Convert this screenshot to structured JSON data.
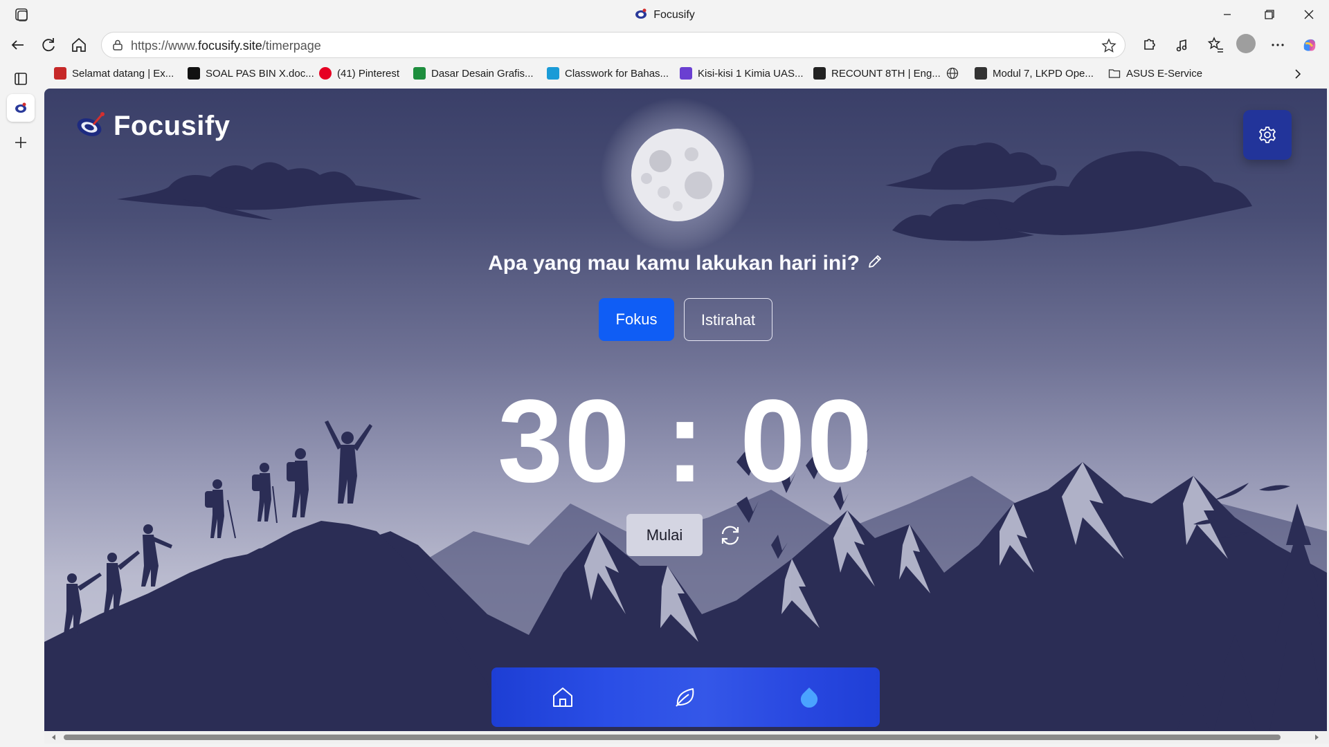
{
  "browser": {
    "window_title": "Focusify",
    "url_prefix": "https://www.",
    "url_domain": "focusify.site",
    "url_path": "/timerpage",
    "bookmarks": [
      {
        "label": "Selamat datang | Ex...",
        "icon": "mail-icon",
        "color": "#c62828"
      },
      {
        "label": "SOAL PAS BIN X.doc...",
        "icon": "doc-icon",
        "color": "#111111"
      },
      {
        "label": "(41) Pinterest",
        "icon": "pinterest-icon",
        "color": "#e60023"
      },
      {
        "label": "Dasar Desain Grafis...",
        "icon": "classroom-icon",
        "color": "#1e8e3e"
      },
      {
        "label": "Classwork for Bahas...",
        "icon": "classroom-icon",
        "color": "#1a9bd7"
      },
      {
        "label": "Kisi-kisi 1 Kimia UAS...",
        "icon": "form-icon",
        "color": "#6a3fd1"
      },
      {
        "label": "RECOUNT 8TH | Eng...",
        "icon": "quizizz-icon",
        "color": "#222222"
      },
      {
        "label": "",
        "icon": "globe-icon",
        "color": "#333333"
      },
      {
        "label": "Modul 7, LKPD Ope...",
        "icon": "folder-person-icon",
        "color": "#333333"
      },
      {
        "label": "ASUS E-Service",
        "icon": "folder-icon",
        "color": "#333333"
      }
    ]
  },
  "app": {
    "brand": "Focusify",
    "headline": "Apa yang mau kamu lakukan hari ini?",
    "modes": {
      "focus": "Fokus",
      "rest": "Istirahat",
      "active": "focus"
    },
    "timer": {
      "minutes": "30",
      "separator": ":",
      "seconds": "00"
    },
    "start_label": "Mulai",
    "nav": [
      "home-icon",
      "leaf-icon",
      "water-drop-icon"
    ],
    "colors": {
      "accent": "#0f5df5",
      "settings": "#22349a",
      "silhouette": "#2b2d55"
    }
  }
}
